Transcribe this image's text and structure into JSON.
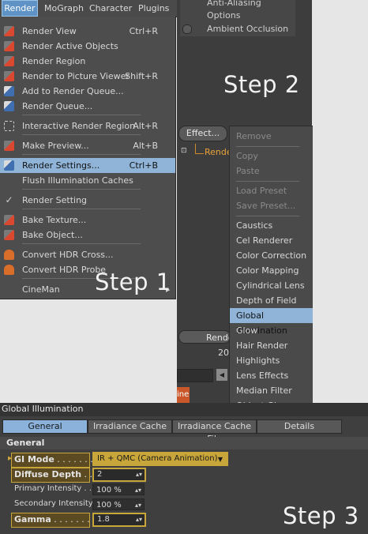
{
  "menubar": {
    "items": [
      "Render",
      "MoGraph",
      "Character",
      "Plugins"
    ]
  },
  "render_menu": {
    "items": [
      {
        "label": "Render View",
        "shortcut": "Ctrl+R",
        "icon": "render-view-icon"
      },
      {
        "label": "Render Active Objects",
        "shortcut": "",
        "icon": "render-objects-icon"
      },
      {
        "label": "Render Region",
        "shortcut": "",
        "icon": "render-region-icon"
      },
      {
        "label": "Render to Picture Viewer",
        "shortcut": "Shift+R",
        "icon": "picture-viewer-icon"
      },
      {
        "label": "Add to Render Queue...",
        "shortcut": "",
        "icon": "add-queue-icon"
      },
      {
        "label": "Render Queue...",
        "shortcut": "",
        "icon": "render-queue-icon"
      },
      {
        "label": "Interactive Render Region",
        "shortcut": "Alt+R",
        "icon": "interactive-region-icon"
      },
      {
        "label": "Make Preview...",
        "shortcut": "Alt+B",
        "icon": "make-preview-icon"
      },
      {
        "label": "Render Settings...",
        "shortcut": "Ctrl+B",
        "icon": "render-settings-icon"
      },
      {
        "label": "Flush Illumination Caches",
        "shortcut": "",
        "icon": ""
      },
      {
        "label": "Render Setting",
        "shortcut": "",
        "icon": "checkmark-icon"
      },
      {
        "label": "Bake Texture...",
        "shortcut": "",
        "icon": "bake-texture-icon"
      },
      {
        "label": "Bake Object...",
        "shortcut": "",
        "icon": "bake-object-icon"
      },
      {
        "label": "Convert HDR Cross...",
        "shortcut": "",
        "icon": "hdr-cross-icon"
      },
      {
        "label": "Convert HDR Probe",
        "shortcut": "",
        "icon": "hdr-probe-icon"
      },
      {
        "label": "CineMan",
        "shortcut": "",
        "icon": ""
      }
    ],
    "highlighted": "Render Settings..."
  },
  "steps": {
    "step1": "Step 1",
    "step2": "Step 2",
    "step3": "Step 3"
  },
  "top_panel": {
    "lines": [
      "Anti-Aliasing",
      "Options",
      "Ambient Occlusion"
    ]
  },
  "effect_panel": {
    "effect_button": "Effect...",
    "render_item": "Rende",
    "render_button": "Rende",
    "number": "20",
    "orange_text": "ine"
  },
  "effects_menu": {
    "disabled": [
      "Remove",
      "Copy",
      "Paste",
      "Load Preset",
      "Save Preset..."
    ],
    "items": [
      "Caustics",
      "Cel Renderer",
      "Color Correction",
      "Color Mapping",
      "Cylindrical Lens",
      "Depth of Field",
      "Global Illumination",
      "Glow",
      "Hair Render",
      "Highlights",
      "Lens Effects",
      "Median Filter",
      "Object Gl..."
    ],
    "highlighted": "Global Illumination"
  },
  "gi_panel": {
    "title": "Global Illumination",
    "tabs": [
      "General",
      "Irradiance Cache",
      "Irradiance Cache File",
      "Details"
    ],
    "active_tab": "General",
    "section": "General",
    "params": [
      {
        "label": "GI Mode",
        "dots": " . . . . . . . . . ",
        "value": "IR + QMC (Camera Animation)",
        "type": "dropdown"
      },
      {
        "label": "Diffuse Depth",
        "dots": " . . . ",
        "value": "2",
        "type": "stepper"
      },
      {
        "label": "Primary Intensity",
        "dots": " . . . ",
        "value": "100 %",
        "type": "stepper"
      },
      {
        "label": "Secondary Intensity",
        "dots": "",
        "value": "100 %",
        "type": "stepper"
      },
      {
        "label": "Gamma",
        "dots": " . . . . . . . . . ",
        "value": "1.8",
        "type": "stepper"
      }
    ]
  },
  "colors": {
    "highlight": "#8fb4d8",
    "accent_gold": "#c9a63a",
    "menu_bg": "#4d4d4d"
  }
}
